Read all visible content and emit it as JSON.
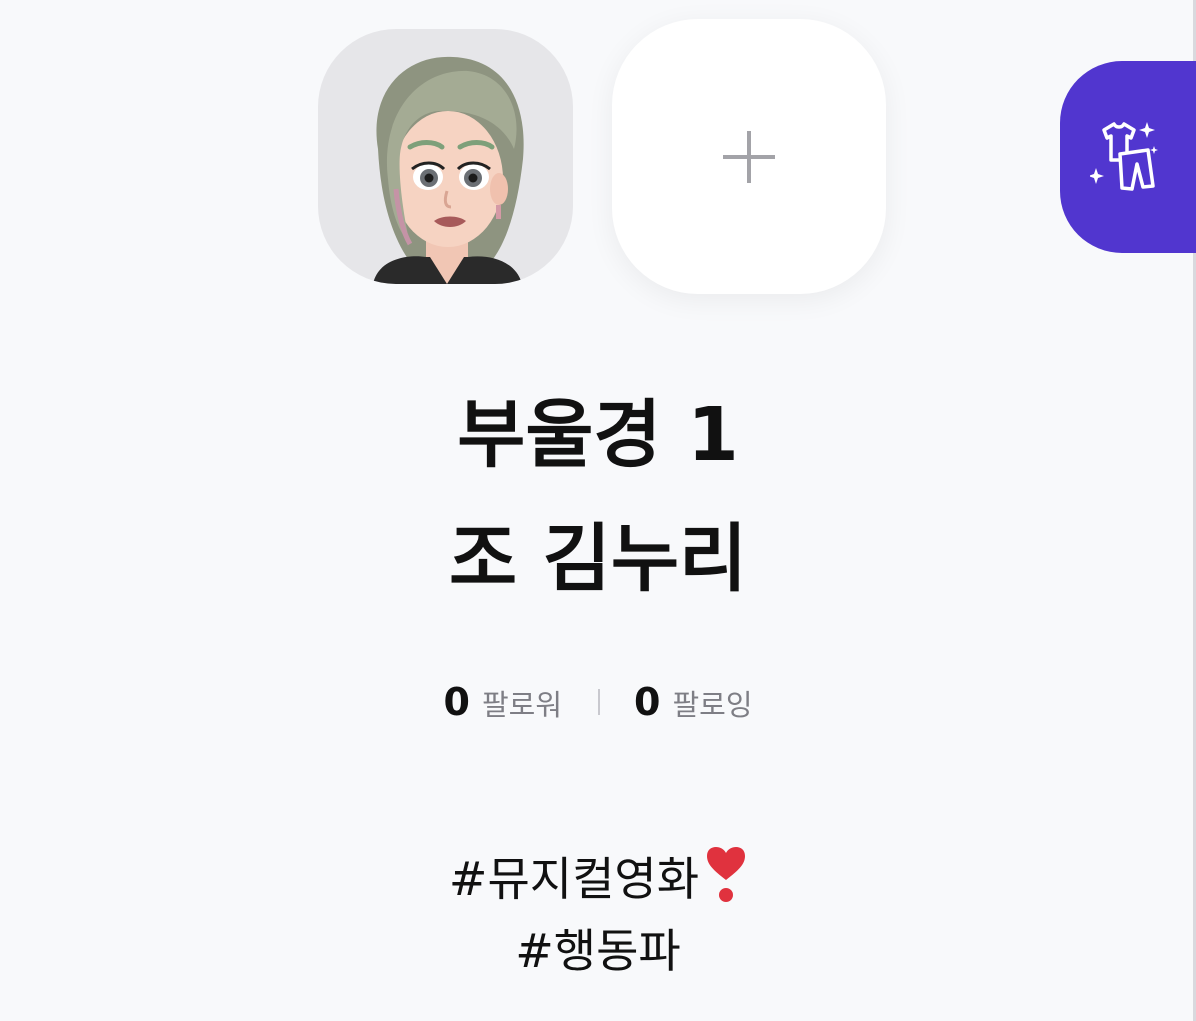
{
  "profile": {
    "name_line1": "부울경 1",
    "name_line2": "조 김누리",
    "add_icon": "plus-icon",
    "avatar_icon": "avatar-image",
    "studio_icon": "outfit-sparkle-icon",
    "accent_color": "#5136cf"
  },
  "stats": {
    "followers_count": "0",
    "followers_label": "팔로워",
    "following_count": "0",
    "following_label": "팔로잉"
  },
  "bio": {
    "line1": "#뮤지컬영화",
    "line1_emoji": "heavy-heart-exclamation",
    "line2": "#행동파"
  }
}
